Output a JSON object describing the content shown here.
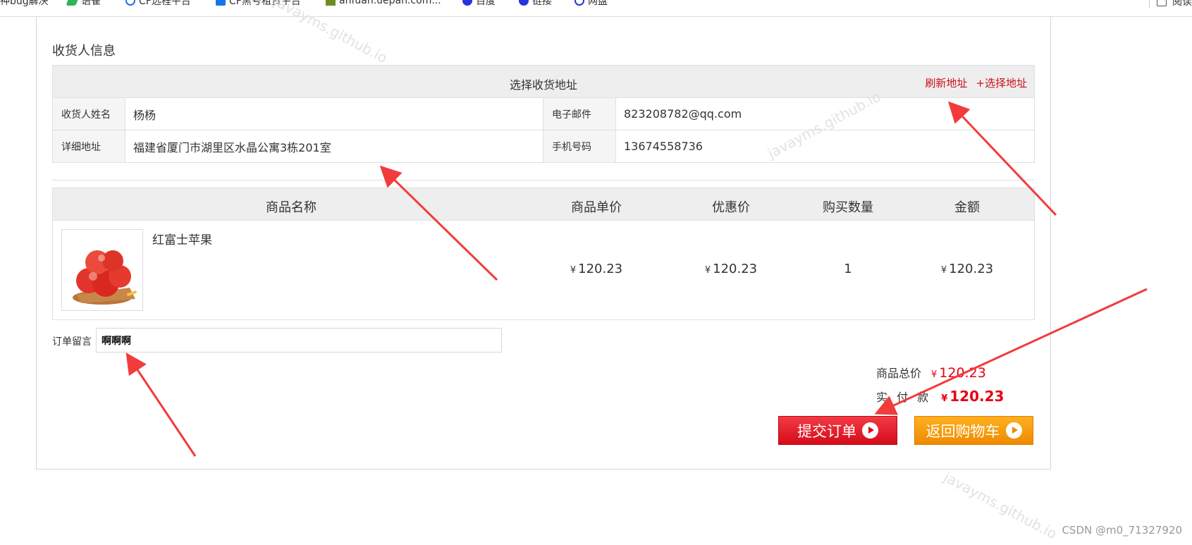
{
  "bookmarks": [
    {
      "label": "神bug解决",
      "color": "#ffffff"
    },
    {
      "label": "语雀",
      "color": "#2fb45a"
    },
    {
      "label": "CF远程平台",
      "color": "#1a73e8"
    },
    {
      "label": "CF黑号租赁平台",
      "color": "#1a73e8"
    },
    {
      "label": "anfuan.uepan.com...",
      "color": "#6b8e23"
    },
    {
      "label": "百度",
      "color": "#2932e1"
    },
    {
      "label": "链接",
      "color": "#2932e1"
    },
    {
      "label": "网盘",
      "color": "#2932e1"
    }
  ],
  "reader_label": "阅读",
  "section_title": "收货人信息",
  "address": {
    "header_title": "选择收货地址",
    "refresh_link": "刷新地址",
    "select_link": "+选择地址",
    "name_label": "收货人姓名",
    "name_value": "杨杨",
    "email_label": "电子邮件",
    "email_value": "823208782@qq.com",
    "detail_label": "详细地址",
    "detail_value": "福建省厦门市湖里区水晶公寓3栋201室",
    "phone_label": "手机号码",
    "phone_value": "13674558736"
  },
  "goods": {
    "headers": [
      "商品名称",
      "商品单价",
      "优惠价",
      "购买数量",
      "金额"
    ],
    "items": [
      {
        "image_icon": "apple-product-image",
        "name": "红富士苹果",
        "currency": "¥",
        "unit_price": "120.23",
        "discount_price": "120.23",
        "quantity": "1",
        "amount": "120.23"
      }
    ]
  },
  "remark": {
    "label": "订单留言",
    "value": "啊啊啊"
  },
  "totals": {
    "goods_total_label": "商品总价",
    "goods_total_value": "120.23",
    "paid_label": "实 付 款",
    "paid_value": "120.23",
    "currency": "¥"
  },
  "buttons": {
    "submit_label": "提交订单",
    "back_label": "返回购物车"
  },
  "watermark_text": "javayms.github.io",
  "csdn_credit": "CSDN @m0_71327920",
  "colors": {
    "accent_red": "#c8101d",
    "price_red": "#e60012",
    "submit_button": "#e60012",
    "back_button": "#f08a00",
    "annotation_arrow": "#f23b3b"
  }
}
